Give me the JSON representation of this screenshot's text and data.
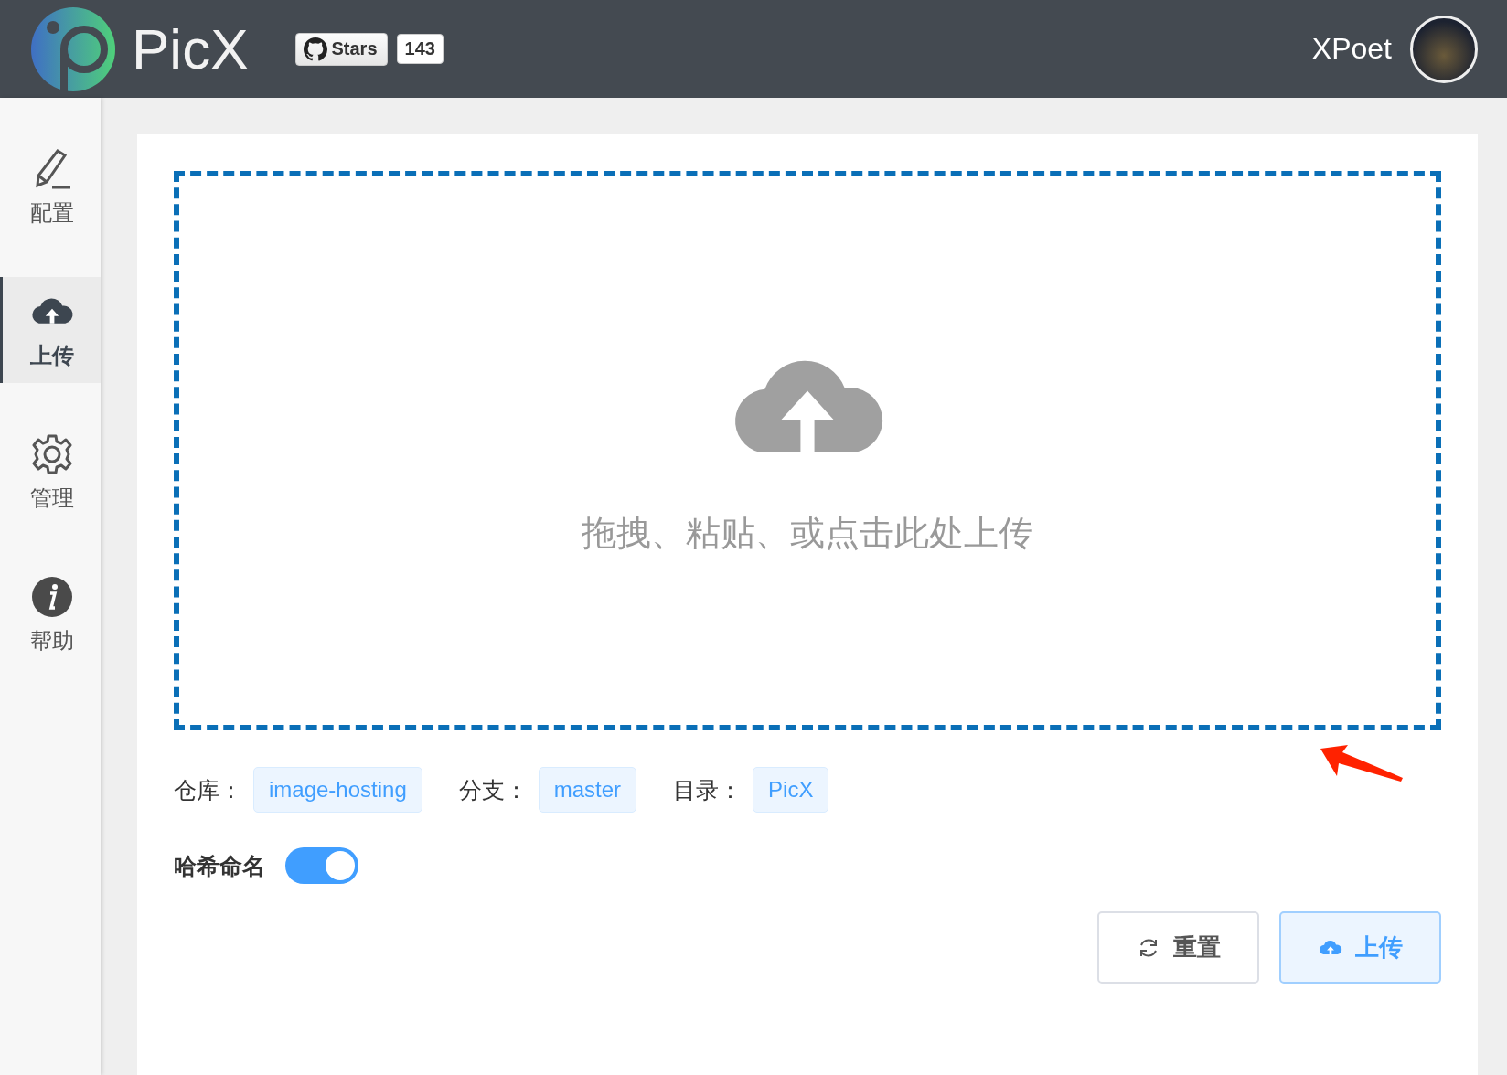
{
  "header": {
    "title": "PicX",
    "stars_button": "Stars",
    "stars_count": "143",
    "user_name": "XPoet"
  },
  "sidebar": {
    "items": [
      {
        "kind": "pencil",
        "label": "配置",
        "selected": false
      },
      {
        "kind": "cloud",
        "label": "上传",
        "selected": true
      },
      {
        "kind": "gear",
        "label": "管理",
        "selected": false
      },
      {
        "kind": "info",
        "label": "帮助",
        "selected": false
      }
    ]
  },
  "dropzone": {
    "hint": "拖拽、粘贴、或点击此处上传"
  },
  "info": [
    {
      "label": "仓库：",
      "value": "image-hosting"
    },
    {
      "label": "分支：",
      "value": "master"
    },
    {
      "label": "目录：",
      "value": "PicX"
    }
  ],
  "hash_naming": {
    "label": "哈希命名",
    "on": true
  },
  "buttons": [
    {
      "kind": "reset",
      "label": "重置"
    },
    {
      "kind": "upload",
      "label": "上传"
    }
  ]
}
